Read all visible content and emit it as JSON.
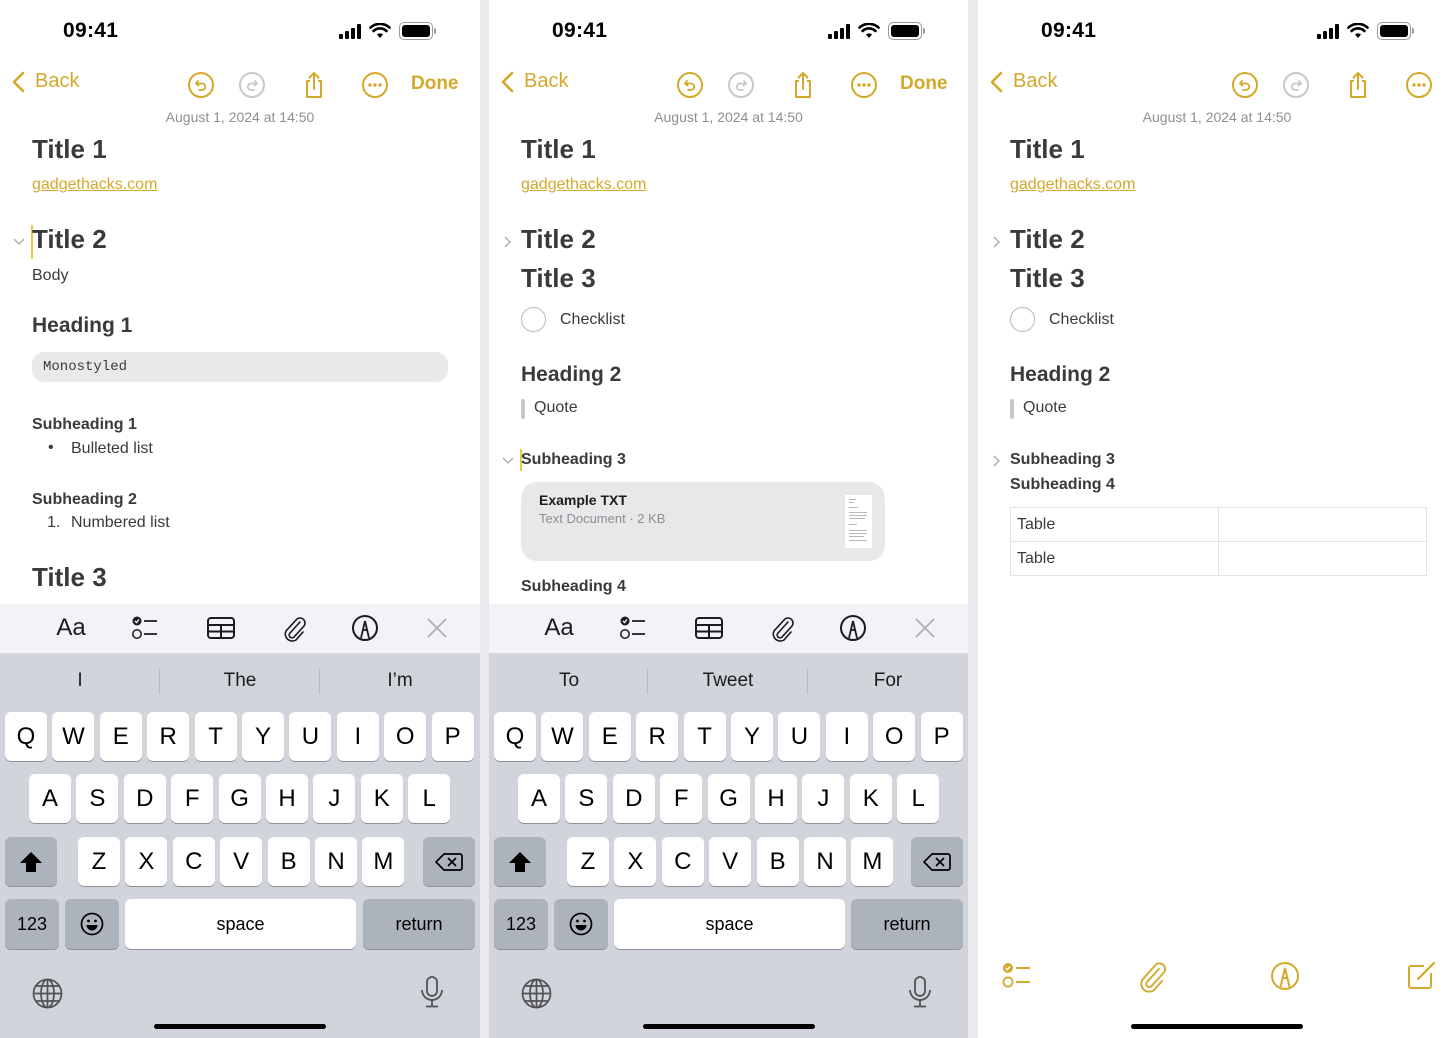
{
  "colors": {
    "accent": "#d4a82a",
    "text": "#3a3a3c",
    "secondary": "#8e8e93",
    "keyboard_bg": "#d1d4da",
    "toolbar_bg": "#f2f2f7"
  },
  "status_bar": {
    "time": "09:41",
    "icons": [
      "cellular-signal-icon",
      "wifi-icon",
      "battery-icon"
    ]
  },
  "nav": {
    "back_label": "Back",
    "done_label": "Done",
    "icons": [
      "undo-icon",
      "redo-icon",
      "share-icon",
      "more-icon"
    ],
    "date": "August 1, 2024 at 14:50"
  },
  "format_toolbar": {
    "items": [
      "text-format-icon (Aa)",
      "checklist-icon",
      "table-icon",
      "attachment-icon",
      "markup-icon",
      "close-icon"
    ],
    "text_format_label": "Aa"
  },
  "keyboard": {
    "row1": [
      "Q",
      "W",
      "E",
      "R",
      "T",
      "Y",
      "U",
      "I",
      "O",
      "P"
    ],
    "row2": [
      "A",
      "S",
      "D",
      "F",
      "G",
      "H",
      "J",
      "K",
      "L"
    ],
    "row3": [
      "Z",
      "X",
      "C",
      "V",
      "B",
      "N",
      "M"
    ],
    "numbers_label": "123",
    "space_label": "space",
    "return_label": "return",
    "icons": [
      "shift-icon",
      "delete-icon",
      "emoji-icon",
      "globe-icon",
      "microphone-icon"
    ]
  },
  "screens": [
    {
      "suggestions": [
        "I",
        "The",
        "I’m"
      ],
      "note": {
        "title1": "Title 1",
        "link": "gadgethacks.com",
        "title2": "Title 2",
        "title2_collapsed": false,
        "body": "Body",
        "heading1": "Heading 1",
        "monostyled": "Monostyled",
        "subheading1": "Subheading 1",
        "bulleted": "Bulleted list",
        "bullet": "•",
        "subheading2": "Subheading 2",
        "numbered_marker": "1.",
        "numbered": "Numbered list",
        "title3": "Title 3"
      }
    },
    {
      "suggestions": [
        "To",
        "Tweet",
        "For"
      ],
      "note": {
        "title1": "Title 1",
        "link": "gadgethacks.com",
        "title2": "Title 2",
        "title2_collapsed": true,
        "title3": "Title 3",
        "checklist": "Checklist",
        "checklist_checked": false,
        "heading2": "Heading 2",
        "quote": "Quote",
        "subheading3": "Subheading 3",
        "subheading3_collapsed": false,
        "attachment": {
          "name": "Example TXT",
          "meta": "Text Document · 2 KB"
        },
        "subheading4": "Subheading 4"
      }
    },
    {
      "note": {
        "title1": "Title 1",
        "link": "gadgethacks.com",
        "title2": "Title 2",
        "title2_collapsed": true,
        "title3": "Title 3",
        "checklist": "Checklist",
        "checklist_checked": false,
        "heading2": "Heading 2",
        "quote": "Quote",
        "subheading3": "Subheading 3",
        "subheading3_collapsed": true,
        "subheading4": "Subheading 4",
        "table": [
          [
            "Table",
            ""
          ],
          [
            "Table",
            ""
          ]
        ]
      },
      "bottom_toolbar": [
        "checklist-icon",
        "attachment-icon",
        "markup-icon",
        "compose-icon"
      ]
    }
  ]
}
